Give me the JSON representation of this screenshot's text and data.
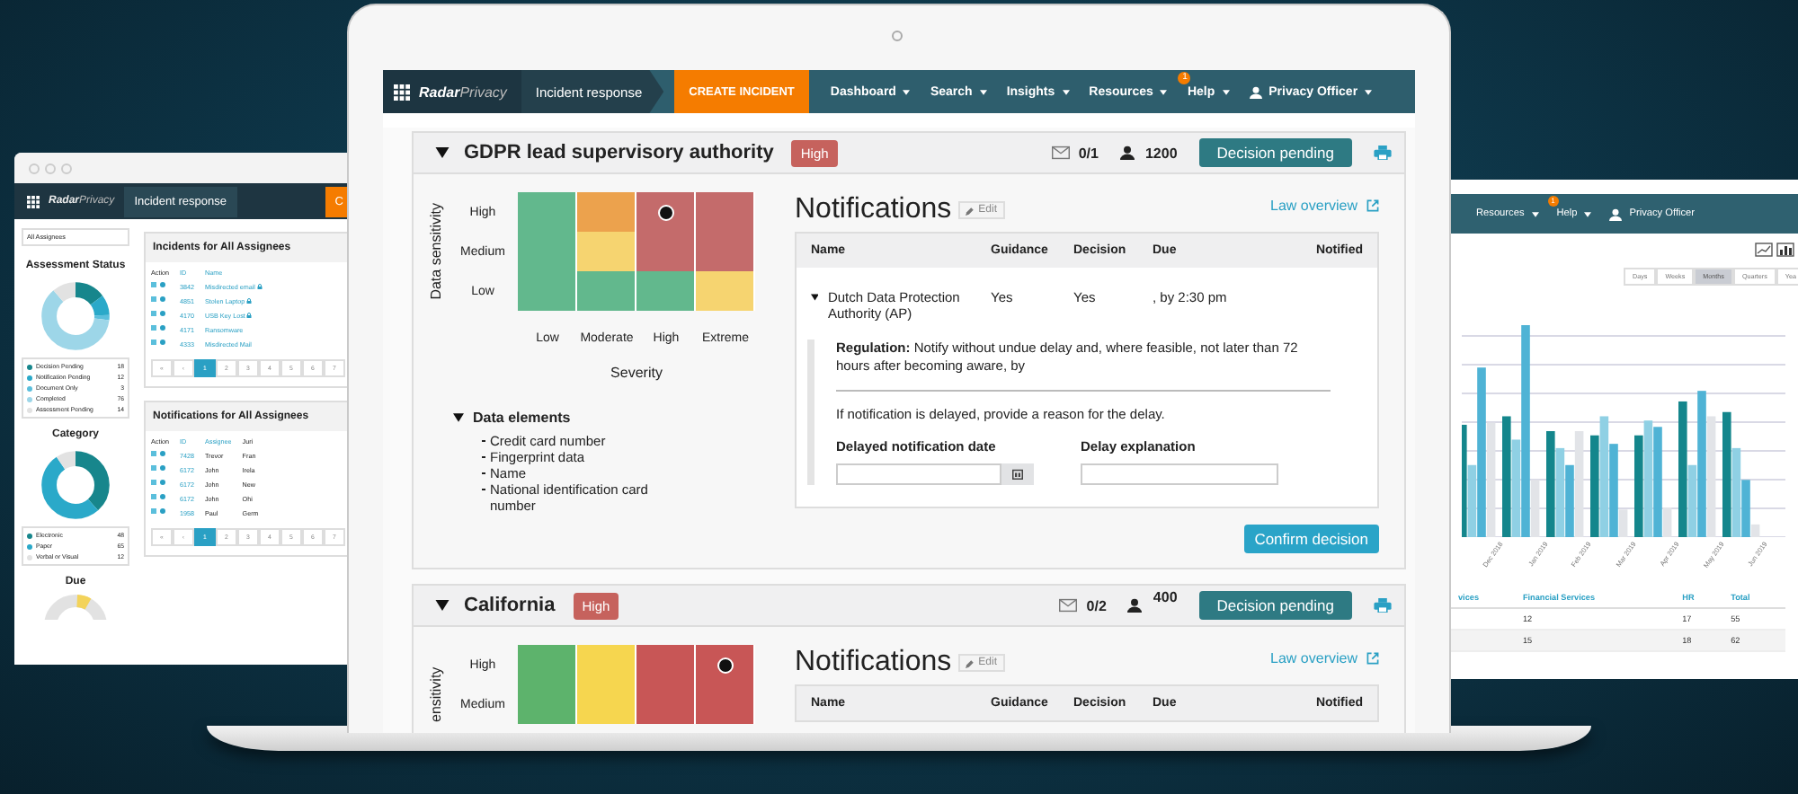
{
  "left_window": {
    "nav": {
      "logo": "Radar",
      "logo_suffix": "Privacy",
      "title": "Incident response",
      "create_button": "C"
    },
    "assignee_select": "All Assignees",
    "assessment": {
      "title": "Assessment Status",
      "legend": [
        {
          "label": "Decision Pending",
          "count": "18",
          "color": "#17868c"
        },
        {
          "label": "Notification Pending",
          "count": "12",
          "color": "#2aa9c9"
        },
        {
          "label": "Document Only",
          "count": "3",
          "color": "#5bbfdc"
        },
        {
          "label": "Completed",
          "count": "76",
          "color": "#9dd6e8"
        },
        {
          "label": "Assessment Pending",
          "count": "14",
          "color": "#e2e2e2"
        }
      ]
    },
    "category": {
      "title": "Category",
      "legend": [
        {
          "label": "Electronic",
          "count": "48",
          "color": "#17868c"
        },
        {
          "label": "Paper",
          "count": "65",
          "color": "#2aa9c9"
        },
        {
          "label": "Verbal or Visual",
          "count": "12",
          "color": "#e2e2e2"
        }
      ]
    },
    "due": {
      "title": "Due"
    },
    "incidents": {
      "title": "Incidents for All Assignees",
      "columns": [
        "Action",
        "ID",
        "Name"
      ],
      "rows": [
        {
          "id": "3842",
          "name": "Misdirected email",
          "locked": true
        },
        {
          "id": "4851",
          "name": "Stolen Laptop",
          "locked": true
        },
        {
          "id": "4170",
          "name": "USB Key Lost",
          "locked": true
        },
        {
          "id": "4171",
          "name": "Ransomware",
          "locked": false
        },
        {
          "id": "4333",
          "name": "Misdirected Mail",
          "locked": false
        }
      ],
      "pager": {
        "first": "«",
        "prev": "‹",
        "pages": [
          {
            "label": "1",
            "selected": true
          },
          {
            "label": "2",
            "selected": false
          },
          {
            "label": "3",
            "selected": false
          },
          {
            "label": "4",
            "selected": false
          },
          {
            "label": "5",
            "selected": false
          },
          {
            "label": "6",
            "selected": false
          },
          {
            "label": "7",
            "selected": false
          }
        ]
      }
    },
    "notifications": {
      "title": "Notifications for All Assignees",
      "columns": [
        "Action",
        "ID",
        "Assignee",
        "Juri"
      ],
      "rows": [
        {
          "id": "7428",
          "assignee": "Trevor",
          "jurisdiction": "Fran"
        },
        {
          "id": "6172",
          "assignee": "John",
          "jurisdiction": "Irela"
        },
        {
          "id": "6172",
          "assignee": "John",
          "jurisdiction": "New"
        },
        {
          "id": "6172",
          "assignee": "John",
          "jurisdiction": "Ohi"
        },
        {
          "id": "1958",
          "assignee": "Paul",
          "jurisdiction": "Germ"
        }
      ],
      "pager": {
        "first": "«",
        "prev": "‹",
        "pages": [
          {
            "label": "1",
            "selected": true
          },
          {
            "label": "2",
            "selected": false
          },
          {
            "label": "3",
            "selected": false
          },
          {
            "label": "4",
            "selected": false
          },
          {
            "label": "5",
            "selected": false
          },
          {
            "label": "6",
            "selected": false
          },
          {
            "label": "7",
            "selected": false
          }
        ]
      }
    }
  },
  "main_window": {
    "nav": {
      "logo": "Radar",
      "logo_suffix": "Privacy",
      "title": "Incident response",
      "create_button": "CREATE INCIDENT",
      "menus": [
        {
          "label": "Dashboard"
        },
        {
          "label": "Search"
        },
        {
          "label": "Insights"
        },
        {
          "label": "Resources"
        },
        {
          "label": "Help",
          "badge": "1"
        }
      ],
      "user": "Privacy Officer"
    },
    "authorities": [
      {
        "title": "GDPR lead supervisory authority",
        "expanded": true,
        "risk": "High",
        "messages": "0/1",
        "people": "1200",
        "status": "Decision pending",
        "matrix": {
          "y_title": "Data sensitivity",
          "x_title": "Severity",
          "x_labels": [
            "Low",
            "Moderate",
            "High",
            "Extreme"
          ],
          "rows": [
            {
              "label": "High",
              "cells": [
                {
                  "color": "#62b88d",
                  "marked": false
                },
                {
                  "color": "#eca24d",
                  "marked": false
                },
                {
                  "color": "#c46b6b",
                  "marked": true
                },
                {
                  "color": "#c46b6b",
                  "marked": false
                }
              ]
            },
            {
              "label": "Medium",
              "cells": [
                {
                  "color": "#62b88d",
                  "marked": false
                },
                {
                  "color": "#f6d470",
                  "marked": false
                },
                {
                  "color": "#c46b6b",
                  "marked": false
                },
                {
                  "color": "#c46b6b",
                  "marked": false
                }
              ]
            },
            {
              "label": "Low",
              "cells": [
                {
                  "color": "#62b88d",
                  "marked": false
                },
                {
                  "color": "#62b88d",
                  "marked": false
                },
                {
                  "color": "#62b88d",
                  "marked": false
                },
                {
                  "color": "#f6d470",
                  "marked": false
                }
              ]
            }
          ]
        },
        "data_elements": {
          "title": "Data elements",
          "expanded": true,
          "items": [
            "Credit card number",
            "Fingerprint data",
            "Name",
            "National identification card number"
          ]
        },
        "notifications": {
          "title": "Notifications",
          "edit": "Edit",
          "law_link": "Law overview",
          "columns": [
            "Name",
            "Guidance",
            "Decision",
            "Due",
            "Notified"
          ],
          "rows": [
            {
              "name": "Dutch Data Protection Authority (AP)",
              "guidance": "Yes",
              "decision": "Yes",
              "due": ", by 2:30 pm",
              "expanded": true,
              "regulation": "**Regulation:** Notify without undue delay and, where feasible, not later than 72 hours after becoming aware, by",
              "delay_note": "If notification is delayed, provide a reason for the delay.",
              "date_label": "Delayed notification date",
              "explanation_label": "Delay explanation"
            }
          ]
        },
        "confirm": "Confirm decision"
      },
      {
        "title": "California",
        "expanded": true,
        "risk": "High",
        "messages": "0/2",
        "people": "400",
        "status": "Decision pending",
        "matrix": {
          "y_title": "ensitivity",
          "rows": [
            {
              "label": "High",
              "cells": [
                {
                  "color": "#5db36c",
                  "marked": false
                },
                {
                  "color": "#f6d64f",
                  "marked": false
                },
                {
                  "color": "#c85656",
                  "marked": false
                },
                {
                  "color": "#c85656",
                  "marked": true
                }
              ]
            },
            {
              "label": "Medium",
              "cells": [
                {
                  "color": "#5db36c",
                  "marked": false
                },
                {
                  "color": "#f6d64f",
                  "marked": false
                },
                {
                  "color": "#c85656",
                  "marked": false
                },
                {
                  "color": "#c85656",
                  "marked": false
                }
              ]
            }
          ]
        },
        "notifications": {
          "title": "Notifications",
          "edit": "Edit",
          "law_link": "Law overview",
          "columns": [
            "Name",
            "Guidance",
            "Decision",
            "Due",
            "Notified"
          ]
        }
      }
    ]
  },
  "right_window": {
    "nav": {
      "menus": [
        {
          "label": "Resources"
        },
        {
          "label": "Help",
          "badge": "1"
        }
      ],
      "user": "Privacy Officer"
    },
    "periods": [
      {
        "label": "Days",
        "selected": false
      },
      {
        "label": "Weeks",
        "selected": false
      },
      {
        "label": "Months",
        "selected": true
      },
      {
        "label": "Quarters",
        "selected": false
      },
      {
        "label": "Yea",
        "selected": false
      }
    ],
    "x_labels": [
      "Dec 2018",
      "Jan 2019",
      "Feb 2019",
      "Mar 2019",
      "Apr 2019",
      "May 2019",
      "Jun 2019"
    ],
    "table": {
      "columns": [
        "vices",
        "Financial Services",
        "HR",
        "Total"
      ],
      "rows": [
        [
          "",
          "12",
          "17",
          "55"
        ],
        [
          "",
          "15",
          "18",
          "62"
        ]
      ]
    }
  }
}
